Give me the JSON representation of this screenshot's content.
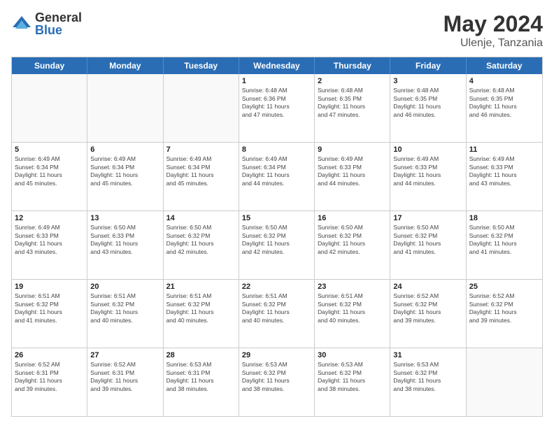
{
  "header": {
    "logo_general": "General",
    "logo_blue": "Blue",
    "month_title": "May 2024",
    "location": "Ulenje, Tanzania"
  },
  "days_of_week": [
    "Sunday",
    "Monday",
    "Tuesday",
    "Wednesday",
    "Thursday",
    "Friday",
    "Saturday"
  ],
  "weeks": [
    [
      {
        "day": "",
        "info": ""
      },
      {
        "day": "",
        "info": ""
      },
      {
        "day": "",
        "info": ""
      },
      {
        "day": "1",
        "info": "Sunrise: 6:48 AM\nSunset: 6:36 PM\nDaylight: 11 hours\nand 47 minutes."
      },
      {
        "day": "2",
        "info": "Sunrise: 6:48 AM\nSunset: 6:35 PM\nDaylight: 11 hours\nand 47 minutes."
      },
      {
        "day": "3",
        "info": "Sunrise: 6:48 AM\nSunset: 6:35 PM\nDaylight: 11 hours\nand 46 minutes."
      },
      {
        "day": "4",
        "info": "Sunrise: 6:48 AM\nSunset: 6:35 PM\nDaylight: 11 hours\nand 46 minutes."
      }
    ],
    [
      {
        "day": "5",
        "info": "Sunrise: 6:49 AM\nSunset: 6:34 PM\nDaylight: 11 hours\nand 45 minutes."
      },
      {
        "day": "6",
        "info": "Sunrise: 6:49 AM\nSunset: 6:34 PM\nDaylight: 11 hours\nand 45 minutes."
      },
      {
        "day": "7",
        "info": "Sunrise: 6:49 AM\nSunset: 6:34 PM\nDaylight: 11 hours\nand 45 minutes."
      },
      {
        "day": "8",
        "info": "Sunrise: 6:49 AM\nSunset: 6:34 PM\nDaylight: 11 hours\nand 44 minutes."
      },
      {
        "day": "9",
        "info": "Sunrise: 6:49 AM\nSunset: 6:33 PM\nDaylight: 11 hours\nand 44 minutes."
      },
      {
        "day": "10",
        "info": "Sunrise: 6:49 AM\nSunset: 6:33 PM\nDaylight: 11 hours\nand 44 minutes."
      },
      {
        "day": "11",
        "info": "Sunrise: 6:49 AM\nSunset: 6:33 PM\nDaylight: 11 hours\nand 43 minutes."
      }
    ],
    [
      {
        "day": "12",
        "info": "Sunrise: 6:49 AM\nSunset: 6:33 PM\nDaylight: 11 hours\nand 43 minutes."
      },
      {
        "day": "13",
        "info": "Sunrise: 6:50 AM\nSunset: 6:33 PM\nDaylight: 11 hours\nand 43 minutes."
      },
      {
        "day": "14",
        "info": "Sunrise: 6:50 AM\nSunset: 6:32 PM\nDaylight: 11 hours\nand 42 minutes."
      },
      {
        "day": "15",
        "info": "Sunrise: 6:50 AM\nSunset: 6:32 PM\nDaylight: 11 hours\nand 42 minutes."
      },
      {
        "day": "16",
        "info": "Sunrise: 6:50 AM\nSunset: 6:32 PM\nDaylight: 11 hours\nand 42 minutes."
      },
      {
        "day": "17",
        "info": "Sunrise: 6:50 AM\nSunset: 6:32 PM\nDaylight: 11 hours\nand 41 minutes."
      },
      {
        "day": "18",
        "info": "Sunrise: 6:50 AM\nSunset: 6:32 PM\nDaylight: 11 hours\nand 41 minutes."
      }
    ],
    [
      {
        "day": "19",
        "info": "Sunrise: 6:51 AM\nSunset: 6:32 PM\nDaylight: 11 hours\nand 41 minutes."
      },
      {
        "day": "20",
        "info": "Sunrise: 6:51 AM\nSunset: 6:32 PM\nDaylight: 11 hours\nand 40 minutes."
      },
      {
        "day": "21",
        "info": "Sunrise: 6:51 AM\nSunset: 6:32 PM\nDaylight: 11 hours\nand 40 minutes."
      },
      {
        "day": "22",
        "info": "Sunrise: 6:51 AM\nSunset: 6:32 PM\nDaylight: 11 hours\nand 40 minutes."
      },
      {
        "day": "23",
        "info": "Sunrise: 6:51 AM\nSunset: 6:32 PM\nDaylight: 11 hours\nand 40 minutes."
      },
      {
        "day": "24",
        "info": "Sunrise: 6:52 AM\nSunset: 6:32 PM\nDaylight: 11 hours\nand 39 minutes."
      },
      {
        "day": "25",
        "info": "Sunrise: 6:52 AM\nSunset: 6:32 PM\nDaylight: 11 hours\nand 39 minutes."
      }
    ],
    [
      {
        "day": "26",
        "info": "Sunrise: 6:52 AM\nSunset: 6:31 PM\nDaylight: 11 hours\nand 39 minutes."
      },
      {
        "day": "27",
        "info": "Sunrise: 6:52 AM\nSunset: 6:31 PM\nDaylight: 11 hours\nand 39 minutes."
      },
      {
        "day": "28",
        "info": "Sunrise: 6:53 AM\nSunset: 6:31 PM\nDaylight: 11 hours\nand 38 minutes."
      },
      {
        "day": "29",
        "info": "Sunrise: 6:53 AM\nSunset: 6:32 PM\nDaylight: 11 hours\nand 38 minutes."
      },
      {
        "day": "30",
        "info": "Sunrise: 6:53 AM\nSunset: 6:32 PM\nDaylight: 11 hours\nand 38 minutes."
      },
      {
        "day": "31",
        "info": "Sunrise: 6:53 AM\nSunset: 6:32 PM\nDaylight: 11 hours\nand 38 minutes."
      },
      {
        "day": "",
        "info": ""
      }
    ]
  ]
}
